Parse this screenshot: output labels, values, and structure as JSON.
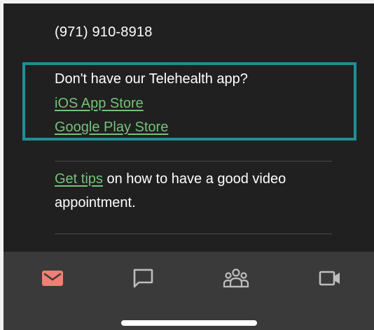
{
  "contact": {
    "phone": "(971) 910-8918"
  },
  "app_promo": {
    "question": "Don't have our Telehealth app?",
    "ios_link": "iOS App Store",
    "google_link": "Google Play Store"
  },
  "tips": {
    "link": "Get tips",
    "text": " on how to have a good video appointment."
  },
  "nav": {
    "items": [
      {
        "name": "messages",
        "icon": "mail-icon",
        "active": true
      },
      {
        "name": "chat",
        "icon": "chat-bubble-icon",
        "active": false
      },
      {
        "name": "groups",
        "icon": "people-icon",
        "active": false
      },
      {
        "name": "video",
        "icon": "video-camera-icon",
        "active": false
      }
    ]
  },
  "colors": {
    "background": "#202020",
    "link": "#76c27a",
    "highlight_border": "#1e8f97",
    "nav_background": "#3a3a3a",
    "nav_active": "#f07f74",
    "nav_inactive": "#bdbdbd"
  }
}
